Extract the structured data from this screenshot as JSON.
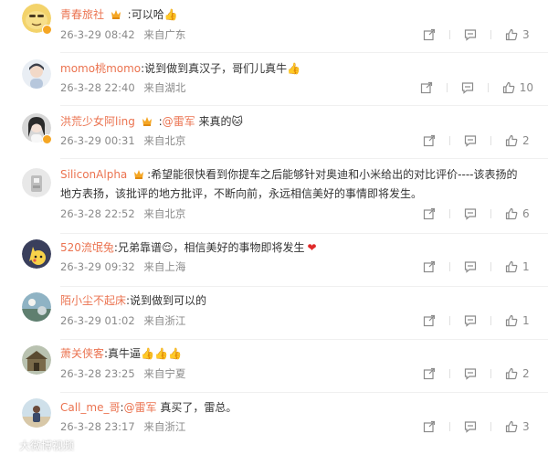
{
  "colors": {
    "username": "#eb7350",
    "meta": "#8a8a8a",
    "text": "#333333",
    "badge": "#f5a623"
  },
  "comments": [
    {
      "username": "青春旅社",
      "content": ":可以哈",
      "mention": "",
      "after_mention": "",
      "time": "26-3-29 08:42",
      "location": "来自广东",
      "likes": "3",
      "has_medal": true,
      "verified": true,
      "emoji": "👍"
    },
    {
      "username": "momo桃momo",
      "content": ":说到做到真汉子，哥们儿真牛",
      "mention": "",
      "after_mention": "",
      "time": "26-3-28 22:40",
      "location": "来自湖北",
      "likes": "10",
      "has_medal": false,
      "verified": false,
      "emoji": "👍"
    },
    {
      "username": "洪荒少女阿ling",
      "content": ":",
      "mention": "@雷军",
      "after_mention": " 来真的",
      "time": "26-3-29 00:31",
      "location": "来自北京",
      "likes": "2",
      "has_medal": true,
      "verified": true,
      "emoji": "🐱"
    },
    {
      "username": "SiliconAlpha",
      "content": ":希望能很快看到你提车之后能够针对奥迪和小米给出的对比评价----该表扬的",
      "content_line2": "地方表扬，该批评的地方批评，不断向前，永远相信美好的事情即将发生。",
      "mention": "",
      "after_mention": "",
      "time": "26-3-28 22:52",
      "location": "来自北京",
      "likes": "6",
      "has_medal": true,
      "verified": false,
      "emoji": ""
    },
    {
      "username": "520流氓兔",
      "content": ":兄弟靠谱",
      "after_emoji": "，相信美好的事物即将发生",
      "mention": "",
      "after_mention": "",
      "time": "26-3-29 09:32",
      "location": "来自上海",
      "likes": "1",
      "has_medal": false,
      "verified": false,
      "emoji": "😌",
      "emoji2": "❤"
    },
    {
      "username": "陌小尘不起床",
      "content": ":说到做到可以的",
      "mention": "",
      "after_mention": "",
      "time": "26-3-29 01:02",
      "location": "来自浙江",
      "likes": "1",
      "has_medal": false,
      "verified": false,
      "emoji": ""
    },
    {
      "username": "萧关侠客",
      "content": ":真牛逼",
      "mention": "",
      "after_mention": "",
      "time": "26-3-28 23:25",
      "location": "来自宁夏",
      "likes": "2",
      "has_medal": false,
      "verified": false,
      "emoji": "👍👍👍"
    },
    {
      "username": "Call_me_哥",
      "content": ":",
      "mention": "@雷军",
      "after_mention": " 真买了，雷总。",
      "time": "26-3-28 23:17",
      "location": "来自浙江",
      "likes": "3",
      "has_medal": false,
      "verified": false,
      "emoji": ""
    }
  ],
  "watermark": {
    "text": "大微博视频"
  },
  "icons": {
    "share": "share-icon",
    "comment": "comment-icon",
    "like": "like-icon",
    "medal": "fan-medal-icon"
  }
}
